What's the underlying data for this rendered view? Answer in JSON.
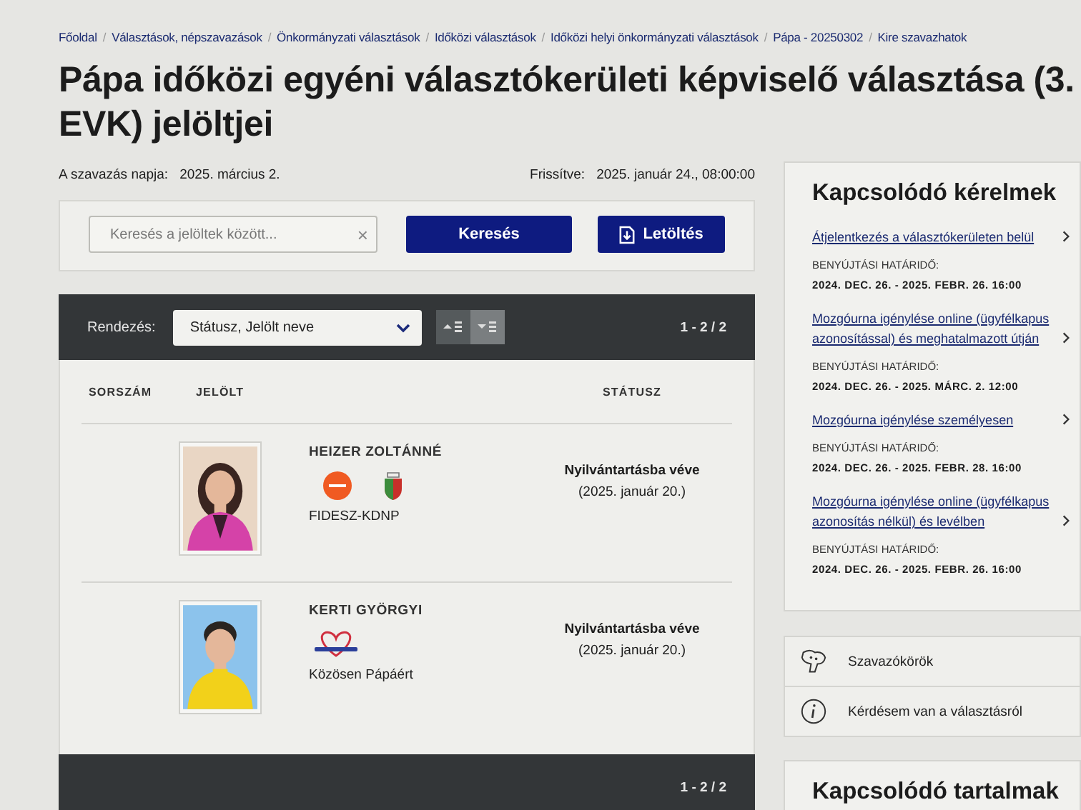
{
  "breadcrumb_separator": "/",
  "breadcrumb": [
    "Főoldal",
    "Választások, népszavazások",
    "Önkormányzati választások",
    "Időközi választások",
    "Időközi helyi önkormányzati választások",
    "Pápa - 20250302",
    "Kire szavazhatok"
  ],
  "title": "Pápa időközi egyéni választókerületi képviselő választása (3. EVK) jelöltjei",
  "dates": [
    {
      "label": "A szavazás napja:",
      "value": "2025. március 2."
    },
    {
      "label": "Frissítve:",
      "value": "2025. január 24., 08:00:00"
    }
  ],
  "search": {
    "placeholder": "Keresés a jelöltek között...",
    "clear": "×",
    "buttons": [
      {
        "kind": "search",
        "label": "Keresés"
      },
      {
        "kind": "download",
        "label": "Letöltés"
      }
    ]
  },
  "results": {
    "sort_label": "Rendezés:",
    "sort_value": "Státusz, Jelölt neve",
    "sort_order": [
      {
        "kind": "asc",
        "selected": false
      },
      {
        "kind": "desc",
        "selected": true
      }
    ],
    "count": "1 - 2 / 2",
    "footer_count": "1 - 2 / 2",
    "columns": [
      "SORSZÁM",
      "JELÖLT",
      "STÁTUSZ"
    ],
    "rows": [
      {
        "name": "HEIZER ZOLTÁNNÉ",
        "logos": [
          {
            "kind": "round"
          },
          {
            "kind": "shield"
          }
        ],
        "party": "FIDESZ-KDNP",
        "status": "Nyilvántartásba véve",
        "status_date": "(2025. január 20.)"
      },
      {
        "name": "KERTI GYÖRGYI",
        "logos": [
          {
            "kind": "heart"
          }
        ],
        "party": "Közösen Pápáért",
        "status": "Nyilvántartásba véve",
        "status_date": "(2025. január 20.)"
      }
    ]
  },
  "sidebar": {
    "title": "Kapcsolódó kérelmek",
    "requests": [
      {
        "link": "Átjelentkezés a választókerületen belül",
        "deadline_label": "BENYÚJTÁSI HATÁRIDŐ:",
        "deadline": "2024. DEC. 26. - 2025. FEBR. 26. 16:00"
      },
      {
        "link": "Mozgóurna igénylése online (ügyfélkapus azonosítással) és meghatalmazott útján",
        "deadline_label": "BENYÚJTÁSI HATÁRIDŐ:",
        "deadline": "2024. DEC. 26. - 2025. MÁRC. 2. 12:00"
      },
      {
        "link": "Mozgóurna igénylése személyesen",
        "deadline_label": "BENYÚJTÁSI HATÁRIDŐ:",
        "deadline": "2024. DEC. 26. - 2025. FEBR. 28. 16:00"
      },
      {
        "link": "Mozgóurna igénylése online (ügyfélkapus azonosítás nélkül) és levélben",
        "deadline_label": "BENYÚJTÁSI HATÁRIDŐ:",
        "deadline": "2024. DEC. 26. - 2025. FEBR. 26. 16:00"
      }
    ],
    "shortcuts": [
      {
        "kind": "map",
        "label": "Szavazókörök"
      },
      {
        "kind": "info",
        "label": "Kérdésem van a választásról"
      }
    ],
    "next_title": "Kapcsolódó tartalmak"
  }
}
